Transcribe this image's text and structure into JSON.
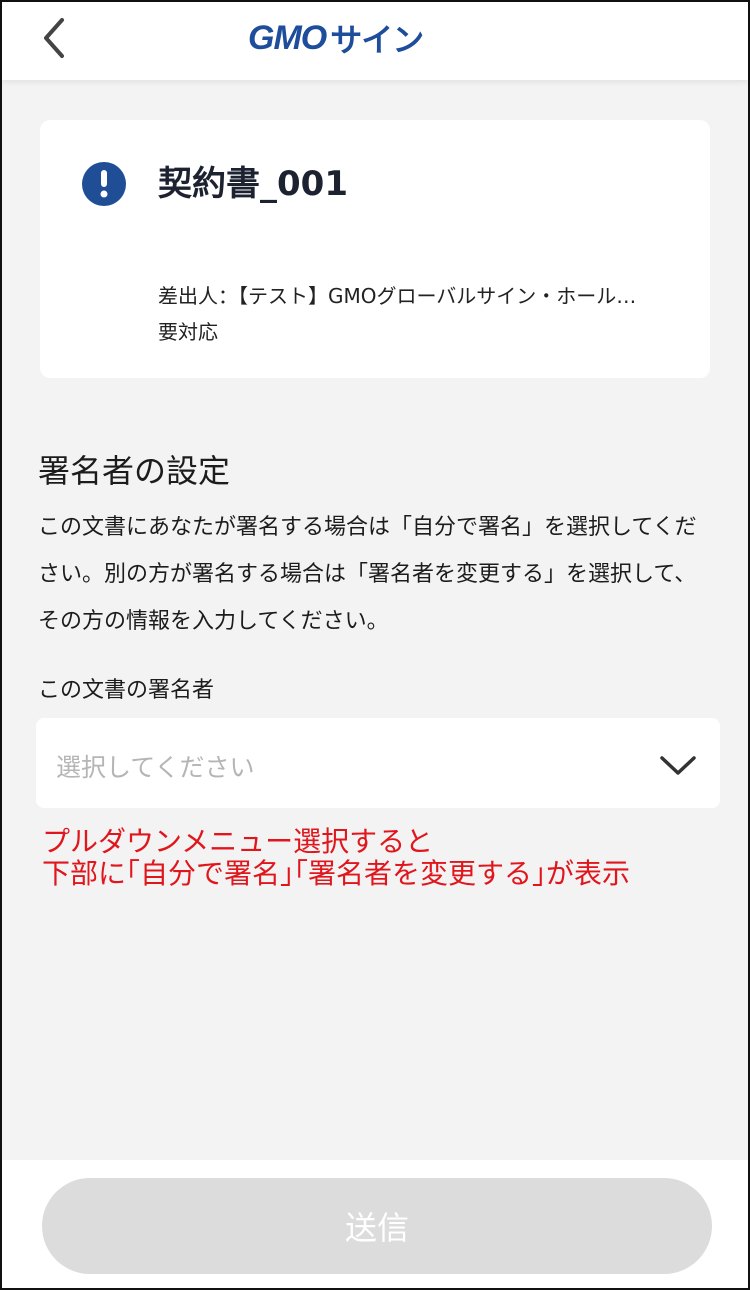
{
  "header": {
    "logo_gmo": "GMO",
    "logo_sign": "サイン",
    "brand_color": "#1d4d9b"
  },
  "document": {
    "title": "契約書_001",
    "sender": "差出人：【テスト】GMOグローバルサイン・ホール…",
    "status": "要対応",
    "icon": "alert-circle-icon",
    "icon_color": "#1f4d96"
  },
  "signer_settings": {
    "title": "署名者の設定",
    "description": "この文書にあなたが署名する場合は「自分で署名」を選択してください。別の方が署名する場合は「署名者を変更する」を選択して、その方の情報を入力してください。",
    "field_label": "この文書の署名者",
    "select_placeholder": "選択してください"
  },
  "annotation": {
    "line1": "プルダウンメニュー選択すると",
    "line2": "下部に｢自分で署名｣｢署名者を変更する｣が表示",
    "color": "#e0161c"
  },
  "footer": {
    "send_label": "送信",
    "send_disabled": true
  }
}
